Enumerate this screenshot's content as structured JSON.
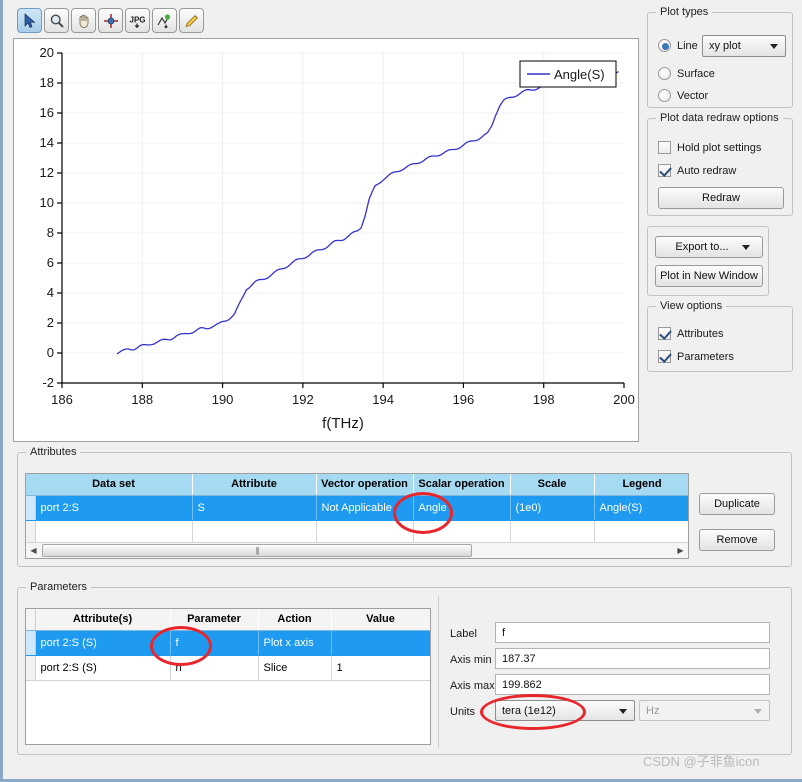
{
  "toolbar": {
    "buttons": [
      {
        "name": "pointer-icon",
        "label": "Pointer",
        "selected": true
      },
      {
        "name": "zoom-icon",
        "label": "Zoom",
        "selected": false
      },
      {
        "name": "pan-hand-icon",
        "label": "Pan",
        "selected": false
      },
      {
        "name": "zoom-fit-icon",
        "label": "Zoom to fit",
        "selected": false
      },
      {
        "name": "export-jpg-icon",
        "label": "JPG",
        "selected": false
      },
      {
        "name": "data-marker-icon",
        "label": "Marker",
        "selected": false
      },
      {
        "name": "pencil-icon",
        "label": "Edit",
        "selected": false
      }
    ]
  },
  "chart_data": {
    "type": "line",
    "title": "",
    "xlabel": "f(THz)",
    "ylabel": "",
    "xlim": [
      186,
      200
    ],
    "ylim": [
      -2,
      20
    ],
    "xticks": [
      186,
      188,
      190,
      192,
      194,
      196,
      198,
      200
    ],
    "yticks": [
      -2,
      0,
      2,
      4,
      6,
      8,
      10,
      12,
      14,
      16,
      18,
      20
    ],
    "grid": true,
    "legend": {
      "position": "top-right",
      "entries": [
        "Angle(S)"
      ]
    },
    "series": [
      {
        "name": "Angle(S)",
        "color": "#3333cc",
        "x": [
          187.37,
          187.5,
          187.65,
          187.8,
          187.95,
          188.1,
          188.25,
          188.4,
          188.55,
          188.7,
          188.85,
          189.0,
          189.15,
          189.3,
          189.45,
          189.6,
          189.75,
          189.9,
          190.0,
          190.1,
          190.2,
          190.3,
          190.45,
          190.6,
          190.8,
          191.0,
          191.2,
          191.4,
          191.6,
          191.8,
          192.0,
          192.2,
          192.4,
          192.6,
          192.8,
          193.0,
          193.2,
          193.35,
          193.45,
          193.55,
          193.65,
          193.8,
          194.0,
          194.2,
          194.45,
          194.7,
          194.95,
          195.2,
          195.45,
          195.7,
          195.95,
          196.2,
          196.45,
          196.6,
          196.7,
          196.8,
          196.9,
          197.0,
          197.15,
          197.35,
          197.6,
          197.9,
          198.2,
          198.5,
          198.8,
          199.1,
          199.4,
          199.7,
          199.862
        ],
        "y": [
          0.0,
          0.1,
          0.25,
          0.3,
          0.45,
          0.5,
          0.65,
          0.75,
          0.85,
          0.95,
          1.15,
          1.2,
          1.35,
          1.45,
          1.6,
          1.65,
          1.8,
          1.9,
          2.05,
          2.2,
          2.4,
          2.6,
          3.4,
          4.3,
          4.7,
          4.9,
          5.2,
          5.5,
          5.8,
          6.1,
          6.35,
          6.6,
          6.85,
          7.1,
          7.4,
          7.6,
          7.9,
          8.1,
          8.4,
          9.2,
          10.2,
          11.1,
          11.6,
          11.9,
          12.25,
          12.5,
          12.8,
          13.05,
          13.3,
          13.5,
          13.8,
          14.1,
          14.4,
          14.6,
          15.1,
          15.9,
          16.5,
          16.8,
          17.0,
          17.25,
          17.5,
          17.7,
          17.95,
          18.1,
          18.25,
          18.4,
          18.55,
          18.6,
          18.7
        ]
      }
    ]
  },
  "plot_types": {
    "group_label": "Plot types",
    "options": [
      {
        "label": "Line",
        "selected": true
      },
      {
        "label": "Surface",
        "selected": false
      },
      {
        "label": "Vector",
        "selected": false
      }
    ],
    "plot_style_value": "xy plot"
  },
  "redraw_options": {
    "group_label": "Plot data redraw options",
    "hold_plot_settings": {
      "label": "Hold plot settings",
      "checked": false
    },
    "auto_redraw": {
      "label": "Auto redraw",
      "checked": true
    },
    "redraw_button": "Redraw"
  },
  "export_section": {
    "export_to": "Export to...",
    "plot_new_window": "Plot in New Window"
  },
  "view_options": {
    "group_label": "View options",
    "attributes": {
      "label": "Attributes",
      "checked": true
    },
    "parameters": {
      "label": "Parameters",
      "checked": true
    }
  },
  "attributes_panel": {
    "group_label": "Attributes",
    "columns": [
      "Data set",
      "Attribute",
      "Vector operation",
      "Scalar operation",
      "Scale",
      "Legend"
    ],
    "rows": [
      {
        "selected": true,
        "cells": [
          "port 2:S",
          "S",
          "Not Applicable",
          "Angle",
          "(1e0)",
          "Angle(S)"
        ]
      }
    ],
    "duplicate_button": "Duplicate",
    "remove_button": "Remove"
  },
  "parameters_panel": {
    "group_label": "Parameters",
    "columns": [
      "Attribute(s)",
      "Parameter",
      "Action",
      "Value"
    ],
    "rows": [
      {
        "selected": true,
        "cells": [
          "port 2:S (S)",
          "f",
          "Plot x axis",
          ""
        ]
      },
      {
        "selected": false,
        "cells": [
          "port 2:S (S)",
          "n",
          "Slice",
          "1"
        ]
      }
    ],
    "form": {
      "label_caption": "Label",
      "label_value": "f",
      "axis_min_caption": "Axis min",
      "axis_min_value": "187.37",
      "axis_max_caption": "Axis max",
      "axis_max_value": "199.862",
      "units_caption": "Units",
      "units_value": "tera (1e12)",
      "units_base_value": "Hz"
    }
  },
  "annotations": {
    "accent_color": "#e8262b",
    "circled_items": [
      "Angle",
      "f",
      "tera (1e12)"
    ]
  },
  "watermark": {
    "text": "CSDN @子非鱼icon"
  }
}
